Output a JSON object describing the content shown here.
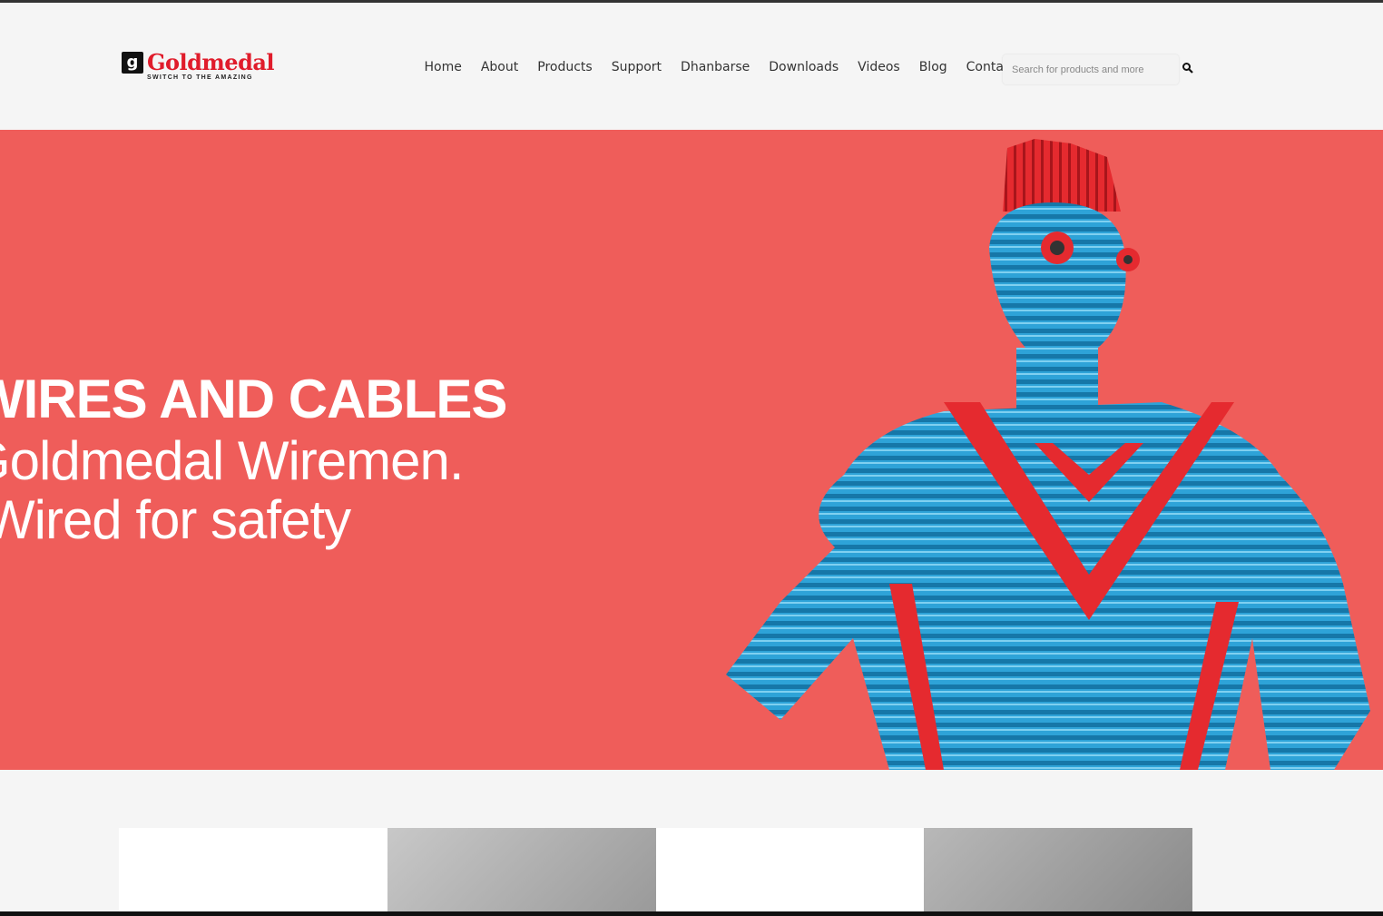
{
  "brand": {
    "name": "Goldmedal",
    "tagline": "SWITCH TO THE AMAZING",
    "colors": {
      "brand_red": "#e01c2b",
      "hero_bg": "#ef5d5a",
      "figure_blue": "#2ea3d8"
    }
  },
  "nav": {
    "items": [
      "Home",
      "About",
      "Products",
      "Support",
      "Dhanbarse",
      "Downloads",
      "Videos",
      "Blog",
      "Contact"
    ]
  },
  "search": {
    "placeholder": "Search for products and more",
    "icon": "search-icon"
  },
  "hero": {
    "line1": "WIRES AND CABLES",
    "line2": "Goldmedal Wiremen.",
    "line3": "Wired for safety"
  }
}
